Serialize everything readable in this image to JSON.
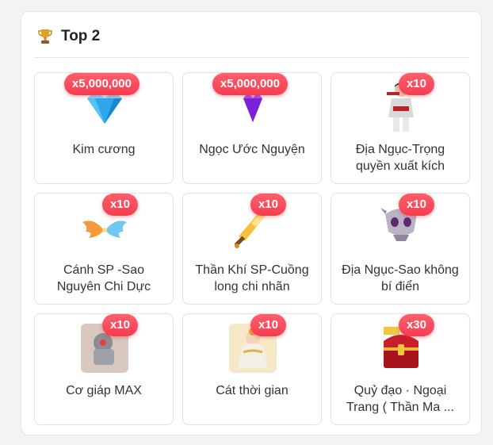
{
  "header": {
    "title": "Top 2",
    "icon": "trophy-icon"
  },
  "items": [
    {
      "name": "Kim cương",
      "qty": "x5,000,000",
      "icon": "diamond-icon"
    },
    {
      "name": "Ngọc Ước Nguyện",
      "qty": "x5,000,000",
      "icon": "purple-gem-icon"
    },
    {
      "name": "Địa Ngục-Trọng quyền xuất kích",
      "qty": "x10",
      "icon": "warrior-costume-icon"
    },
    {
      "name": "Cánh SP -Sao Nguyên Chi Dực",
      "qty": "x10",
      "icon": "wings-icon"
    },
    {
      "name": "Thần Khí SP-Cuồng long chi nhãn",
      "qty": "x10",
      "icon": "golden-sword-icon"
    },
    {
      "name": "Địa Ngục-Sao không bí điển",
      "qty": "x10",
      "icon": "demon-mask-icon"
    },
    {
      "name": "Cơ giáp MAX",
      "qty": "x10",
      "icon": "mecha-icon"
    },
    {
      "name": "Cát thời gian",
      "qty": "x10",
      "icon": "time-sand-icon"
    },
    {
      "name": "Quỷ đạo · Ngoại Trang ( Thần Ma ...",
      "qty": "x30",
      "icon": "treasure-chest-icon"
    }
  ]
}
